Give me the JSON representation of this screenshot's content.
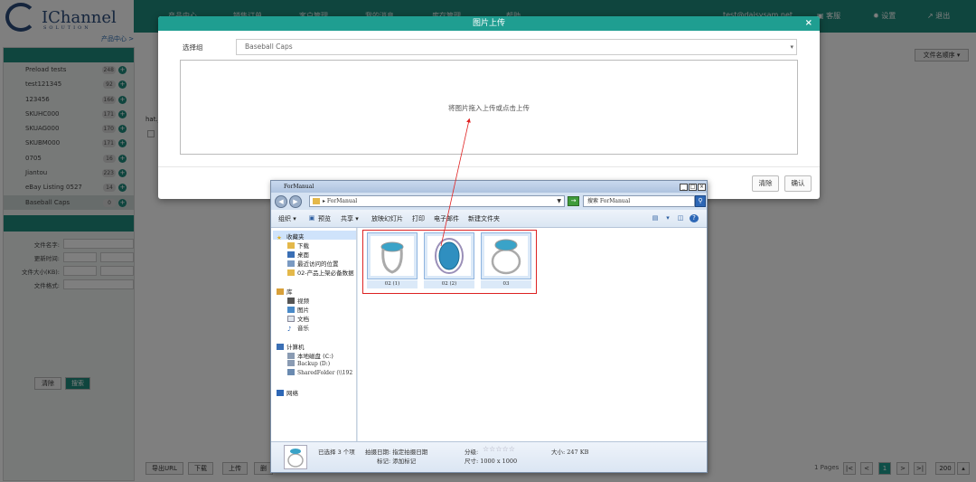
{
  "brand": {
    "name": "IChannel",
    "tagline": "SOLUTION"
  },
  "topnav": {
    "items": [
      "产品中心",
      "销售订单",
      "客户管理",
      "我的消息",
      "库存管理",
      "帮助"
    ],
    "user": "test@daisysam.net",
    "service": "客服",
    "settings": "设置",
    "logout": "退出"
  },
  "breadcrumb": "产品中心 >",
  "sidebar": {
    "groups": [
      {
        "label": "Preload tests",
        "count": "248"
      },
      {
        "label": "test121345",
        "count": "92"
      },
      {
        "label": "123456",
        "count": "166"
      },
      {
        "label": "SKUHC000",
        "count": "171"
      },
      {
        "label": "SKUAG000",
        "count": "170"
      },
      {
        "label": "SKUBM000",
        "count": "171"
      },
      {
        "label": "0705",
        "count": "16"
      },
      {
        "label": "Jiantou",
        "count": "223"
      },
      {
        "label": "eBay Listing 0527",
        "count": "14"
      },
      {
        "label": "Baseball Caps",
        "count": "0"
      }
    ],
    "filters": {
      "filename": "文件名字:",
      "upload_date": "更新时间:",
      "size": "文件大小(KB):",
      "format": "文件格式:"
    },
    "clear_label": "清除",
    "search_label": "搜索"
  },
  "main": {
    "sort_label": "文件名顺序 ▾",
    "filename_fragment": "hat.j",
    "buttons": [
      "导出URL",
      "下载",
      "上传",
      "删"
    ],
    "pager": {
      "pages": "1 Pages",
      "current": "1",
      "per_page": "200"
    }
  },
  "modal": {
    "title": "图片上传",
    "close": "×",
    "group_label": "选择组",
    "group_value": "Baseball Caps",
    "drop_hint": "将图片拖入上传或点击上传",
    "clear_label": "清除",
    "confirm_label": "确认"
  },
  "explorer": {
    "title": "ForManual",
    "address": "▸ ForManual",
    "search_placeholder": "搜索 ForManual",
    "toolbar": [
      "组织 ▾",
      "预览",
      "共享 ▾",
      "放映幻灯片",
      "打印",
      "电子邮件",
      "新建文件夹"
    ],
    "nav": {
      "favorites": "收藏夹",
      "favorite_items": [
        "下载",
        "桌面",
        "最近访问的位置",
        "02-产品上架必备数据"
      ],
      "library": "库",
      "library_items": [
        "视频",
        "图片",
        "文档",
        "音乐"
      ],
      "computer": "计算机",
      "computer_items": [
        "本地磁盘 (C:)",
        "Backup (D:)",
        "SharedFolder (\\\\192"
      ],
      "network": "网络"
    },
    "files": [
      "02 (1)",
      "02 (2)",
      "03"
    ],
    "status": {
      "selected": "已选择 3 个项",
      "date_label": "拍摄日期: 指定拍摄日期",
      "tag_label": "标记: 添加标记",
      "rating_label": "分级:",
      "stars": "☆☆☆☆☆",
      "size_label": "大小: 247 KB",
      "dims_label": "尺寸: 1000 x 1000"
    }
  },
  "colors": {
    "brand_teal": "#1f8b7d",
    "modal_header": "#1f9e91",
    "highlight_red": "#dd2222"
  }
}
